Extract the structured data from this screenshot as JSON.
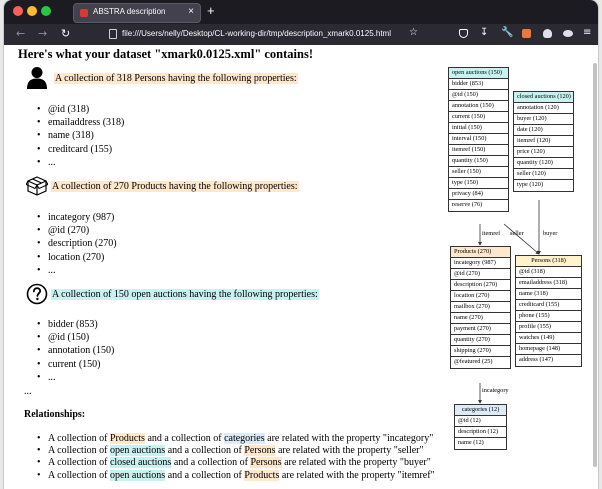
{
  "browser": {
    "tab_title": "ABSTRA description",
    "tab_close": "×",
    "new_tab": "+",
    "url": "file:///Users/nelly/Desktop/CL-working-dir/tmp/description_xmark0.0125.html",
    "icons": {
      "back": "arrow-left-icon",
      "forward": "arrow-right-icon",
      "reload": "reload-icon",
      "bookmark": "star-icon",
      "pocket": "pocket-icon",
      "downloads": "download-icon",
      "tools": "wrench-icon",
      "menu": "hamburger-menu-icon"
    }
  },
  "page": {
    "title": "Here's what your dataset \"xmark0.0125.xml\" contains!",
    "collections": [
      {
        "icon": "person-icon",
        "label": "A collection of 318 Persons having the following properties:",
        "properties": [
          "@id (318)",
          "emailaddress (318)",
          "name (318)",
          "creditcard (155)",
          "..."
        ]
      },
      {
        "icon": "box-icon",
        "label": "A collection of 270 Products having the following properties:",
        "properties": [
          "incategory (987)",
          "@id (270)",
          "description (270)",
          "location (270)",
          "..."
        ]
      },
      {
        "icon": "question-circle-icon",
        "label": "A collection of 150 open auctions having the following properties:",
        "properties": [
          "bidder (853)",
          "@id (150)",
          "annotation (150)",
          "current (150)",
          "..."
        ]
      }
    ],
    "more": "...",
    "relationships_title": "Relationships:",
    "relationships": [
      {
        "pre": "A collection of ",
        "a": "Products",
        "mid": " and a collection of ",
        "b": "categories",
        "post": " are related with the property \"incategory\""
      },
      {
        "pre": "A collection of ",
        "a": "open auctions",
        "mid": " and a collection of ",
        "b": "Persons",
        "post": " are related with the property \"seller\""
      },
      {
        "pre": "A collection of ",
        "a": "closed auctions",
        "mid": " and a collection of ",
        "b": "Persons",
        "post": " are related with the property \"buyer\""
      },
      {
        "pre": "A collection of ",
        "a": "open auctions",
        "mid": " and a collection of ",
        "b": "Products",
        "post": " are related with the property \"itemref\""
      }
    ]
  },
  "diagram": {
    "colors": {
      "open_auctions": "#c9f1f1",
      "closed_auctions": "#c9f1f1",
      "products": "#fde7cd",
      "persons": "#fff3cc",
      "categories": "#dcebf7"
    },
    "open_auctions": {
      "title": "open auctions (150)",
      "rows": [
        "bidder (853)",
        "@id (150)",
        "annotation (150)",
        "current (150)",
        "initial (150)",
        "interval (150)",
        "itemref (150)",
        "quantity (150)",
        "seller (150)",
        "type (150)",
        "privacy (84)",
        "reserve (76)"
      ]
    },
    "closed_auctions": {
      "title": "closed auctions (120)",
      "rows": [
        "annotation (120)",
        "buyer (120)",
        "date (120)",
        "itemref (120)",
        "price (120)",
        "quantity (120)",
        "seller (120)",
        "type (120)"
      ]
    },
    "products": {
      "title": "Products (270)",
      "rows": [
        "incategory (987)",
        "@id (270)",
        "description (270)",
        "location (270)",
        "mailbox (270)",
        "name (270)",
        "payment (270)",
        "quantity (270)",
        "shipping (270)",
        "@featured (25)"
      ]
    },
    "persons": {
      "title": "Persons (318)",
      "rows": [
        "@id (318)",
        "emailaddress (318)",
        "name (318)",
        "creditcard (155)",
        "phone (155)",
        "profile (155)",
        "watches (149)",
        "homepage (148)",
        "address (147)"
      ]
    },
    "categories": {
      "title": "categories (12)",
      "rows": [
        "@id (12)",
        "description (12)",
        "name (12)"
      ]
    },
    "edges": {
      "itemref": "itemref",
      "seller": "seller",
      "buyer": "buyer",
      "incategory": "incategory"
    }
  }
}
